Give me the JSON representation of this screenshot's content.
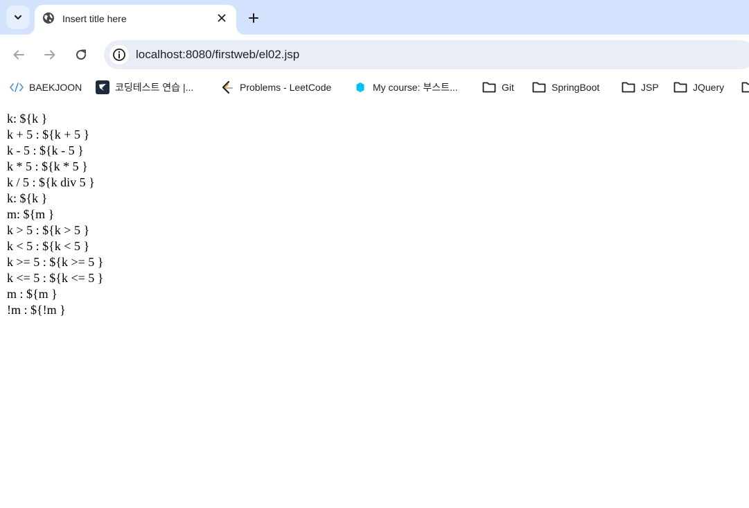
{
  "tab": {
    "title": "Insert title here",
    "close_glyph": "✕",
    "new_tab_glyph": "+"
  },
  "address_bar": {
    "url": "localhost:8080/firstweb/el02.jsp"
  },
  "bookmarks": [
    {
      "label": "BAEKJOON",
      "icon": "code-icon"
    },
    {
      "label": "코딩테스트 연습 |...",
      "icon": "programmers-icon"
    },
    {
      "label": "Problems - LeetCode",
      "icon": "leetcode-icon"
    },
    {
      "label": "My course: 부스트...",
      "icon": "boostcourse-icon"
    },
    {
      "label": "Git",
      "icon": "folder-icon"
    },
    {
      "label": "SpringBoot",
      "icon": "folder-icon"
    },
    {
      "label": "JSP",
      "icon": "folder-icon"
    },
    {
      "label": "JQuery",
      "icon": "folder-icon"
    }
  ],
  "page_lines": [
    "k: ${k }",
    "k + 5 : ${k + 5 }",
    "k - 5 : ${k - 5 }",
    "k * 5 : ${k * 5 }",
    "k / 5 : ${k div 5 }",
    "k: ${k }",
    "m: ${m }",
    "k > 5 : ${k > 5 }",
    "k < 5 : ${k < 5 }",
    "k >= 5 : ${k >= 5 }",
    "k <= 5 : ${k <= 5 }",
    "m : ${m }",
    "!m : ${!m }"
  ],
  "colors": {
    "tabstrip": "#d3e3fd",
    "omnibox": "#e9eef6",
    "icon": "#474747"
  }
}
